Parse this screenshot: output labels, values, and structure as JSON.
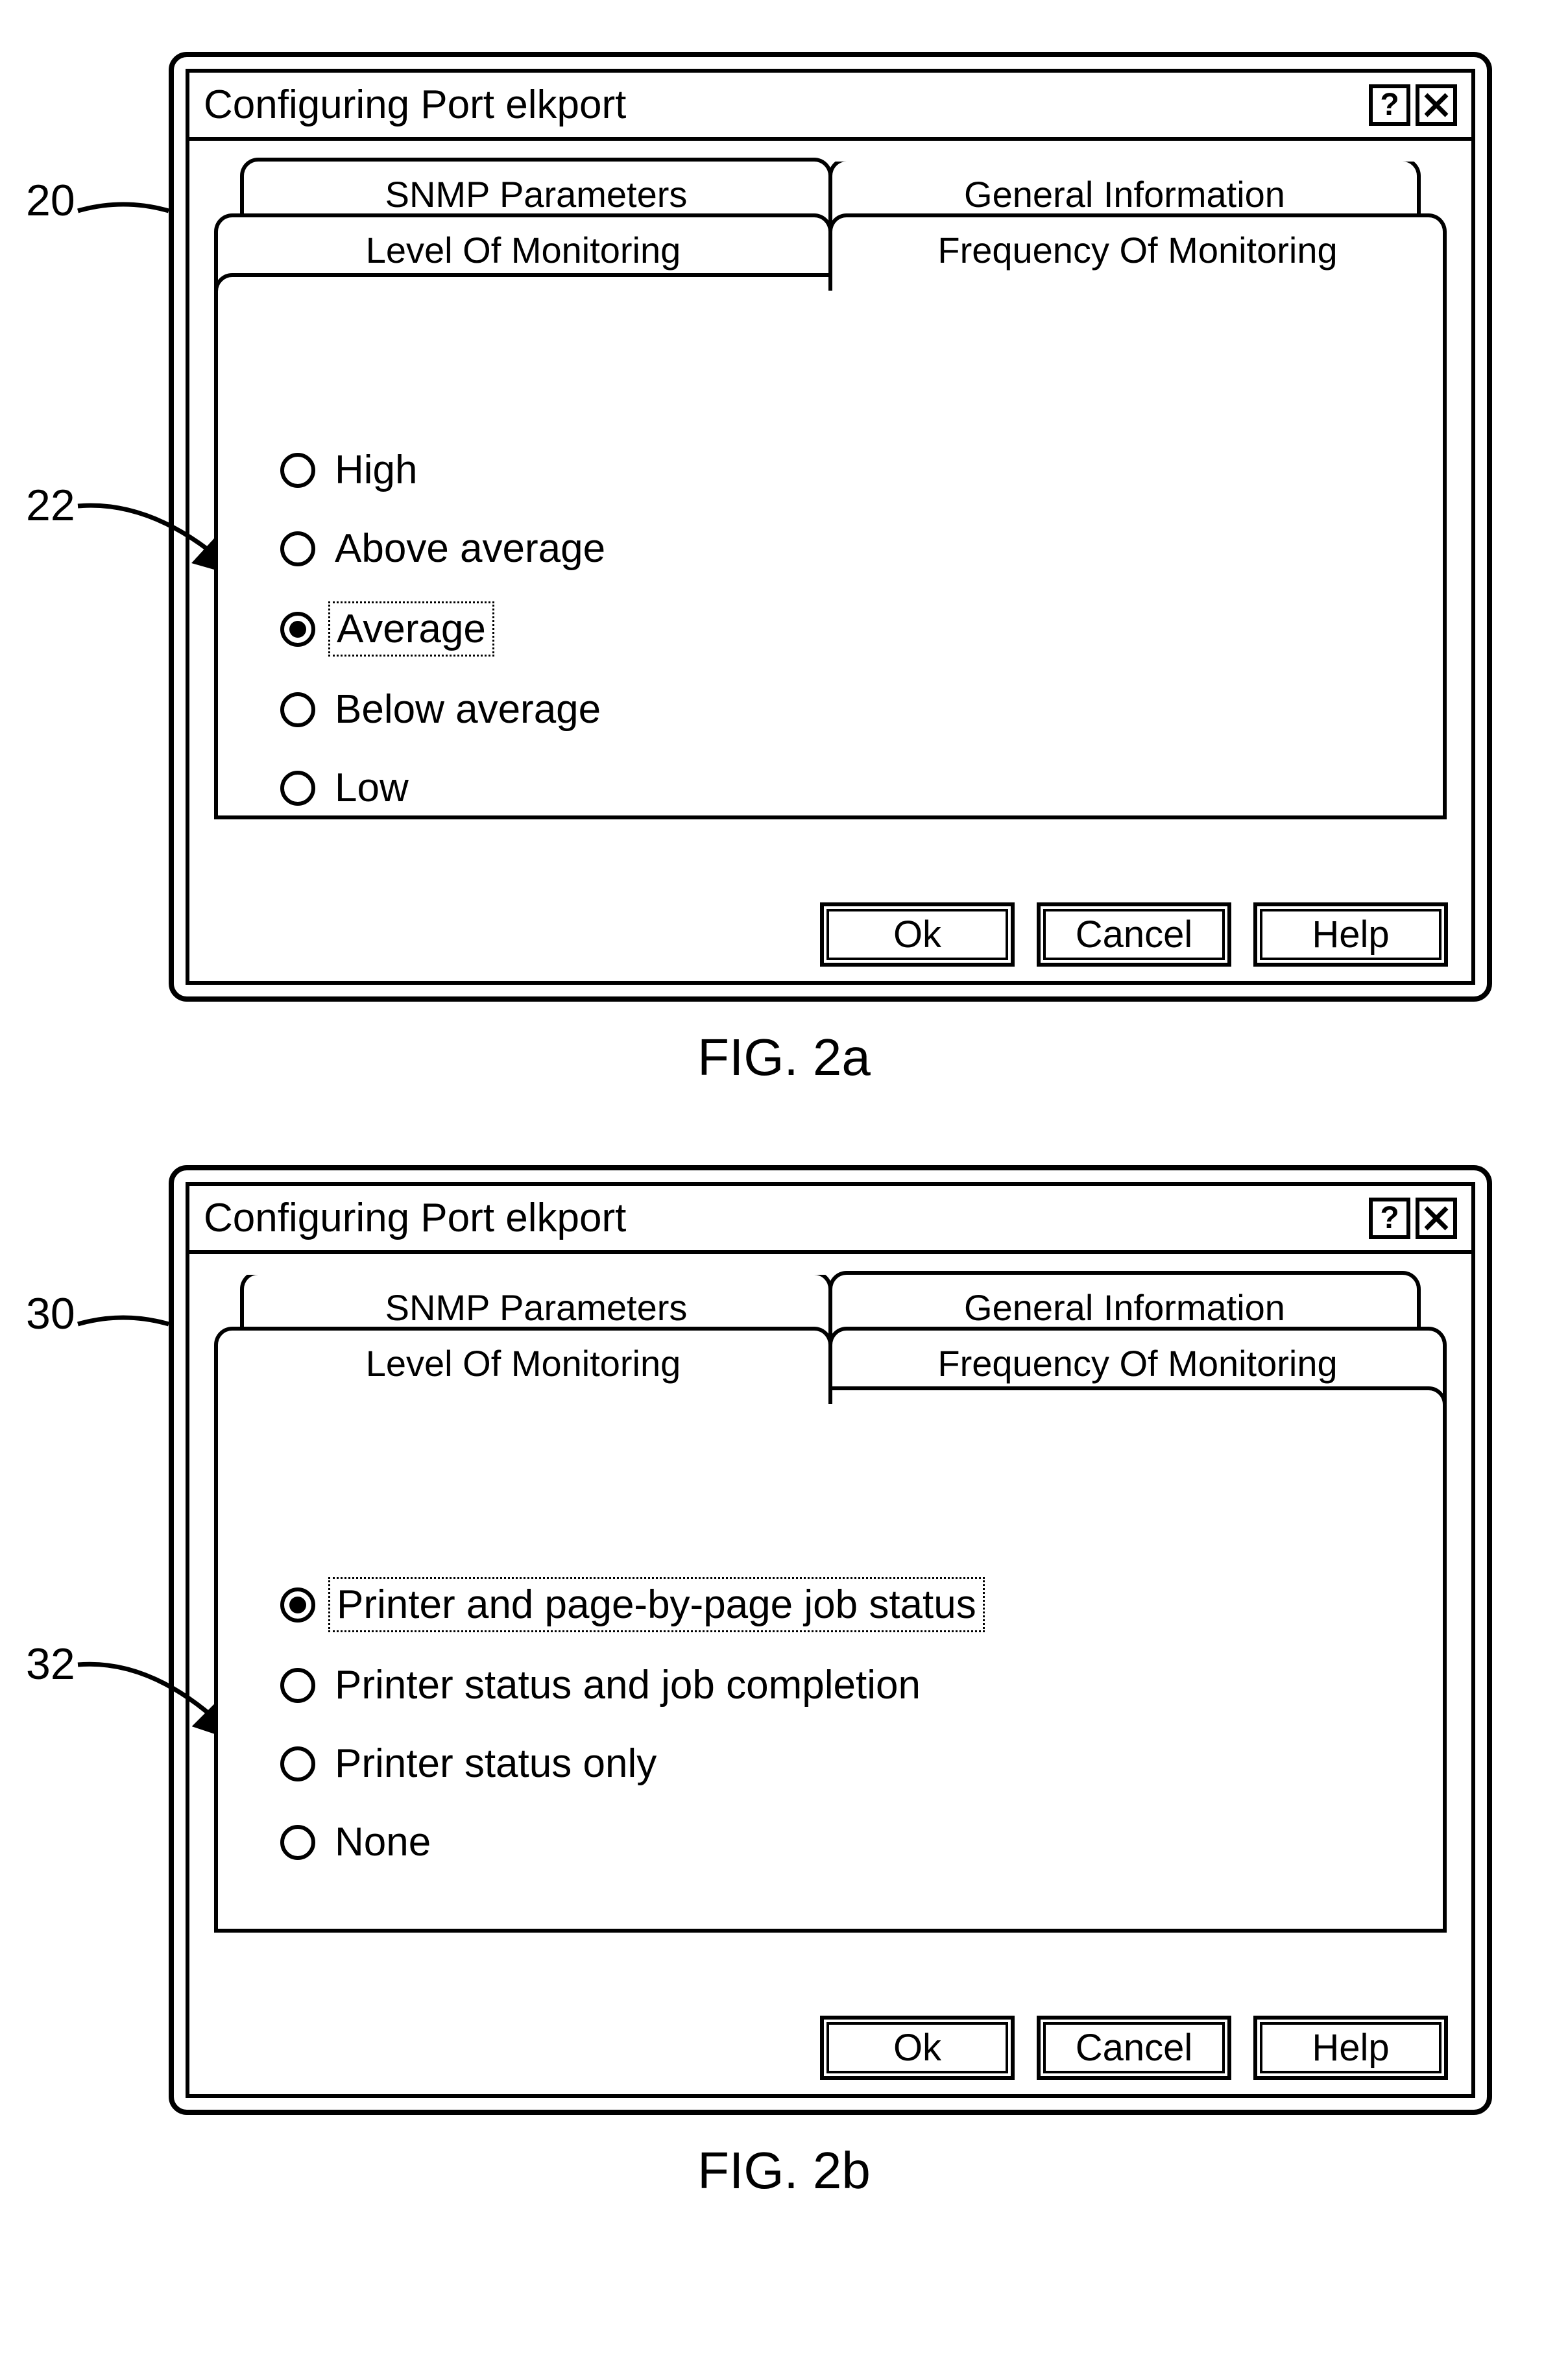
{
  "fig_a": {
    "callouts": {
      "c20": "20",
      "c22": "22"
    },
    "title": "Configuring Port elkport",
    "help_glyph": "?",
    "back_tabs": [
      "SNMP Parameters",
      "General Information"
    ],
    "front_tabs": [
      "Level Of Monitoring",
      "Frequency Of Monitoring"
    ],
    "active_front_index": 1,
    "radios": [
      {
        "label": "High",
        "selected": false,
        "focused": false
      },
      {
        "label": "Above average",
        "selected": false,
        "focused": false
      },
      {
        "label": "Average",
        "selected": true,
        "focused": true
      },
      {
        "label": "Below average",
        "selected": false,
        "focused": false
      },
      {
        "label": "Low",
        "selected": false,
        "focused": false
      }
    ],
    "buttons": {
      "ok": "Ok",
      "cancel": "Cancel",
      "help": "Help"
    },
    "caption": "FIG. 2a"
  },
  "fig_b": {
    "callouts": {
      "c30": "30",
      "c32": "32"
    },
    "title": "Configuring Port elkport",
    "help_glyph": "?",
    "back_tabs": [
      "SNMP Parameters",
      "General Information"
    ],
    "front_tabs": [
      "Level Of Monitoring",
      "Frequency Of Monitoring"
    ],
    "active_front_index": 0,
    "radios": [
      {
        "label": "Printer and page-by-page job status",
        "selected": true,
        "focused": true
      },
      {
        "label": "Printer status and job completion",
        "selected": false,
        "focused": false
      },
      {
        "label": "Printer status only",
        "selected": false,
        "focused": false
      },
      {
        "label": "None",
        "selected": false,
        "focused": false
      }
    ],
    "buttons": {
      "ok": "Ok",
      "cancel": "Cancel",
      "help": "Help"
    },
    "caption": "FIG. 2b"
  }
}
